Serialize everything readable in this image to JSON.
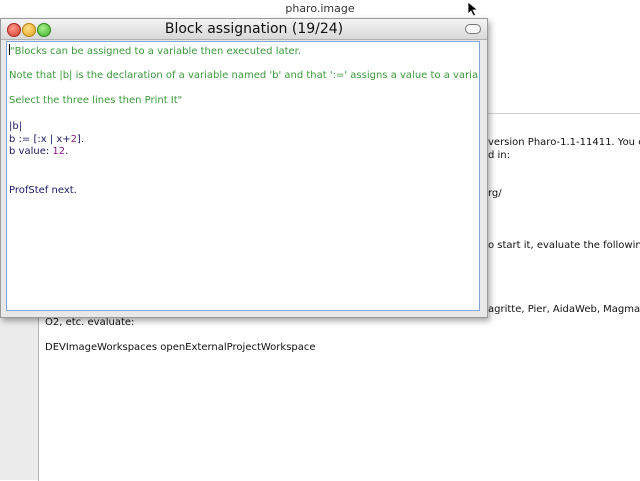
{
  "system": {
    "title": "pharo.image"
  },
  "background_window": {
    "lines": [
      "version Pharo-1.1-11411. You c",
      "d in:",
      "rg/",
      "o start it, evaluate the following",
      "agritte, Pier, AidaWeb, Magma, M",
      "O2, etc. evaluate:",
      "DEVImageWorkspaces openExternalProjectWorkspace"
    ]
  },
  "window": {
    "title": "Block assignation (19/24)",
    "editor": {
      "comment_lines": [
        "\"Blocks can be assigned to a variable then executed later.",
        "",
        "Note that |b| is the declaration of a variable named 'b' and that ':=' assigns a value to a variable.",
        "",
        "Select the three lines then Print It\""
      ],
      "code": {
        "decl": "|b|",
        "assign_prefix": "b := [:x | x+",
        "assign_num": "2",
        "assign_suffix": "].",
        "value_prefix": "b value: ",
        "value_num": "12",
        "value_suffix": ".",
        "next": "ProfStef next."
      }
    }
  },
  "icons": {
    "close": "close-icon",
    "minimize": "minimize-icon",
    "maximize": "maximize-icon",
    "collapse": "collapse-icon",
    "cursor": "mouse-pointer-icon"
  },
  "colors": {
    "comment": "#3a9a3a",
    "code": "#1b1b63",
    "number": "#8a1a8a"
  }
}
